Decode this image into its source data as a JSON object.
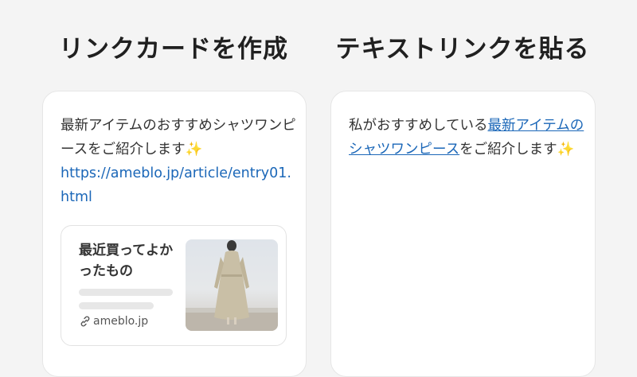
{
  "left": {
    "title": "リンクカードを作成",
    "message": "最新アイテムのおすすめシャツワンピースをご紹介します",
    "sparkle": "✨",
    "url": "https://ameblo.jp/article/entry01.html",
    "card": {
      "title": "最近買ってよかったもの",
      "domain": "ameblo.jp",
      "icon": "link-icon"
    }
  },
  "right": {
    "title": "テキストリンクを貼る",
    "prefix": "私がおすすめしている",
    "link_text": "最新アイテムのシャツワンピース",
    "suffix": "をご紹介します",
    "sparkle": "✨"
  },
  "colors": {
    "link": "#1b67b8",
    "background": "#f4f4f4"
  }
}
